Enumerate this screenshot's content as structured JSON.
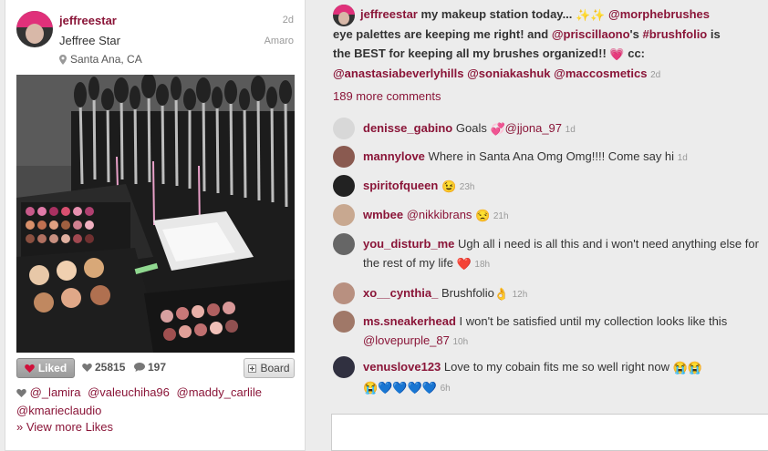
{
  "post": {
    "username": "jeffreestar",
    "full_name": "Jeffree Star",
    "time": "2d",
    "filter": "Amaro",
    "location": "Santa Ana, CA",
    "liked_label": "Liked",
    "like_count": "25815",
    "comment_count": "197",
    "board_label": "Board",
    "likers": [
      "@_lamira",
      "@valeuchiha96",
      "@maddy_carlile",
      "@kmarieclaudio"
    ],
    "view_more": "» View more Likes"
  },
  "caption": {
    "username": "jeffreestar",
    "text_1": "my makeup station today...",
    "mention_1": "@morphebrushes",
    "text_2": "eye palettes are keeping me right! and",
    "mention_2": "@priscillaono",
    "text_3": "'s",
    "hashtag": "#brushfolio",
    "text_4": "is the BEST for keeping all my brushes organized!!",
    "text_5": "cc:",
    "mention_3": "@anastasiabeverlyhills",
    "mention_4": "@soniakashuk",
    "mention_5": "@maccosmetics",
    "time": "2d",
    "more_comments": "189 more comments"
  },
  "comments": [
    {
      "user": "denisse_gabino",
      "text": "Goals",
      "mention": "@jjona_97",
      "time": "1d"
    },
    {
      "user": "mannylove",
      "text": "Where in Santa Ana Omg Omg!!!! Come say hi",
      "time": "1d"
    },
    {
      "user": "spiritofqueen",
      "time": "23h"
    },
    {
      "user": "wmbee",
      "mention": "@nikkibrans",
      "time": "21h"
    },
    {
      "user": "you_disturb_me",
      "text": "Ugh all i need is all this and i won't need anything else for the rest of my life",
      "time": "18h"
    },
    {
      "user": "xo__cynthia_",
      "text": "Brushfolio",
      "time": "12h"
    },
    {
      "user": "ms.sneakerhead",
      "text": "I won't be satisfied until my collection looks like this",
      "mention": "@lovepurple_87",
      "time": "10h"
    },
    {
      "user": "venuslove123",
      "text": "Love to my cobain fits me so well right now",
      "time": "6h"
    }
  ],
  "colors": {
    "link": "#8a1538",
    "heart": "#d0103a",
    "hair_pink": "#e0307a"
  }
}
